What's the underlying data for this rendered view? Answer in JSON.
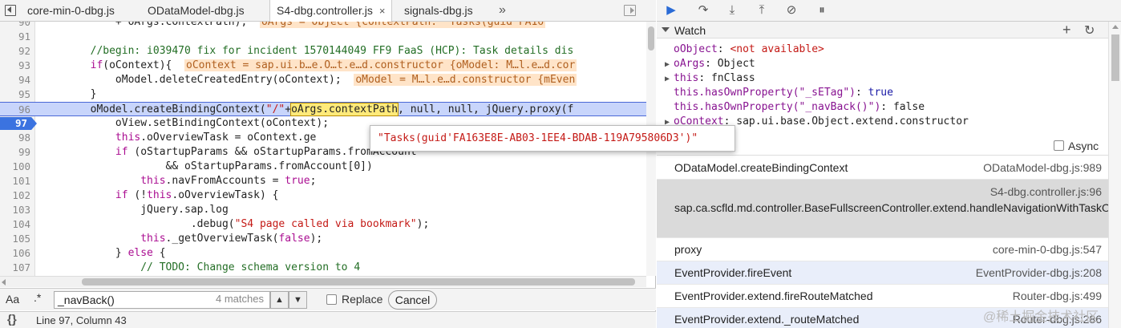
{
  "tabs": [
    "core-min-0-dbg.js",
    "ODataModel-dbg.js",
    "S4-dbg.controller.js",
    "signals-dbg.js"
  ],
  "tab_close": "×",
  "tab_more": "»",
  "code_lines": [
    {
      "ln": "90",
      "segs": [
        [
          "",
          "            + oArgs.contextPath);  "
        ],
        [
          "iv",
          "oArgs = Object {contextPath: \"Tasks(guid'FA16"
        ]
      ]
    },
    {
      "ln": "91",
      "segs": [
        [
          "",
          ""
        ]
      ]
    },
    {
      "ln": "92",
      "segs": [
        [
          "cm",
          "        //begin: i039470 fix for incident 1570144049 FF9 FaaS (HCP): Task details dis"
        ]
      ]
    },
    {
      "ln": "93",
      "segs": [
        [
          "kw",
          "        if"
        ],
        [
          "",
          "(oContext){  "
        ],
        [
          "iv",
          "oContext = sap.ui.b…e.O…t.e…d.constructor {oModel: M…l.e…d.cor"
        ]
      ]
    },
    {
      "ln": "94",
      "segs": [
        [
          "",
          "            oModel.deleteCreatedEntry(oContext);  "
        ],
        [
          "iv",
          "oModel = M…l.e…d.constructor {mEven"
        ]
      ]
    },
    {
      "ln": "95",
      "segs": [
        [
          "",
          "        }"
        ]
      ]
    },
    {
      "ln": "96",
      "segs": [
        [
          "",
          "        oModel.createBindingContext("
        ],
        [
          "str",
          "\"/\""
        ],
        [
          "",
          "+"
        ],
        [
          "hl",
          "oArgs.contextPath"
        ],
        [
          "",
          ", null, null, jQuery.proxy(f"
        ]
      ]
    },
    {
      "ln": "97",
      "segs": [
        [
          "",
          "            oView.setBindingContext(oContext);"
        ]
      ]
    },
    {
      "ln": "98",
      "segs": [
        [
          "kw",
          "            this"
        ],
        [
          "",
          ".oOverviewTask = oContext.ge"
        ]
      ]
    },
    {
      "ln": "99",
      "segs": [
        [
          "kw",
          "            if"
        ],
        [
          "",
          " (oStartupParams && oStartupParams.fromAccount"
        ]
      ]
    },
    {
      "ln": "100",
      "segs": [
        [
          "",
          "                    && oStartupParams.fromAccount[0])"
        ]
      ]
    },
    {
      "ln": "101",
      "segs": [
        [
          "kw",
          "                this"
        ],
        [
          "",
          ".navFromAccounts = "
        ],
        [
          "kw",
          "true"
        ],
        [
          "",
          ";"
        ]
      ]
    },
    {
      "ln": "102",
      "segs": [
        [
          "kw",
          "            if"
        ],
        [
          "",
          " (!"
        ],
        [
          "kw",
          "this"
        ],
        [
          "",
          ".oOverviewTask) {"
        ]
      ]
    },
    {
      "ln": "103",
      "segs": [
        [
          "",
          "                jQuery.sap.log"
        ]
      ]
    },
    {
      "ln": "104",
      "segs": [
        [
          "",
          "                        .debug("
        ],
        [
          "str",
          "\"S4 page called via bookmark\""
        ],
        [
          "",
          ");"
        ]
      ]
    },
    {
      "ln": "105",
      "segs": [
        [
          "kw",
          "                this"
        ],
        [
          "",
          "._getOverviewTask("
        ],
        [
          "kw",
          "false"
        ],
        [
          "",
          ");"
        ]
      ]
    },
    {
      "ln": "106",
      "segs": [
        [
          "",
          "            } "
        ],
        [
          "kw",
          "else"
        ],
        [
          "",
          " {"
        ]
      ]
    },
    {
      "ln": "107",
      "segs": [
        [
          "cm",
          "                // TODO: Change schema version to 4"
        ]
      ]
    },
    {
      "ln": "108",
      "segs": [
        [
          "",
          ""
        ]
      ]
    }
  ],
  "tooltip": "\"Tasks(guid'FA163E8E-AB03-1EE4-BDAB-119A795806D3')\"",
  "find": {
    "aa": "Aa",
    "regex": ".*",
    "query": "_navBack()",
    "count": "4 matches",
    "replace_label": "Replace",
    "cancel_label": "Cancel"
  },
  "status": {
    "brackets": "{}",
    "position": "Line 97, Column 43"
  },
  "watch": {
    "title": "Watch",
    "items": [
      {
        "exp": "",
        "name": "oObject",
        "sep": ": ",
        "value": "<not available>",
        "cls": "na"
      },
      {
        "exp": "▶",
        "name": "oArgs",
        "sep": ": ",
        "value": "Object",
        "cls": "vl"
      },
      {
        "exp": "▶",
        "name": "this",
        "sep": ": ",
        "value": "fnClass",
        "cls": "vl"
      },
      {
        "exp": "",
        "name": "this.hasOwnProperty(\"_sETag\")",
        "sep": ": ",
        "value": "true",
        "cls": "tr"
      },
      {
        "exp": "",
        "name": "this.hasOwnProperty(\"_navBack()\")",
        "sep": ": ",
        "value": "false",
        "cls": "vl"
      },
      {
        "exp": "▶",
        "name": "oContext",
        "sep": ": ",
        "value": "sap.ui.base.Object.extend.constructor",
        "cls": "vl"
      }
    ]
  },
  "async_label": "Async",
  "callstack": [
    {
      "fn": "ODataModel.createBindingContext",
      "loc": "ODataModel-dbg.js:989"
    },
    {
      "fn": "sap.ca.scfld.md.controller.BaseFullscreenController.extend.handleNavigationWithTaskOverview",
      "loc": "S4-dbg.controller.js:96"
    },
    {
      "fn": "proxy",
      "loc": "core-min-0-dbg.js:547"
    },
    {
      "fn": "EventProvider.fireEvent",
      "loc": "EventProvider-dbg.js:208"
    },
    {
      "fn": "EventProvider.extend.fireRouteMatched",
      "loc": "Router-dbg.js:499"
    },
    {
      "fn": "EventProvider.extend._routeMatched",
      "loc": "Router-dbg.js:286"
    }
  ],
  "watermark": "@稀土掘金技术社区"
}
